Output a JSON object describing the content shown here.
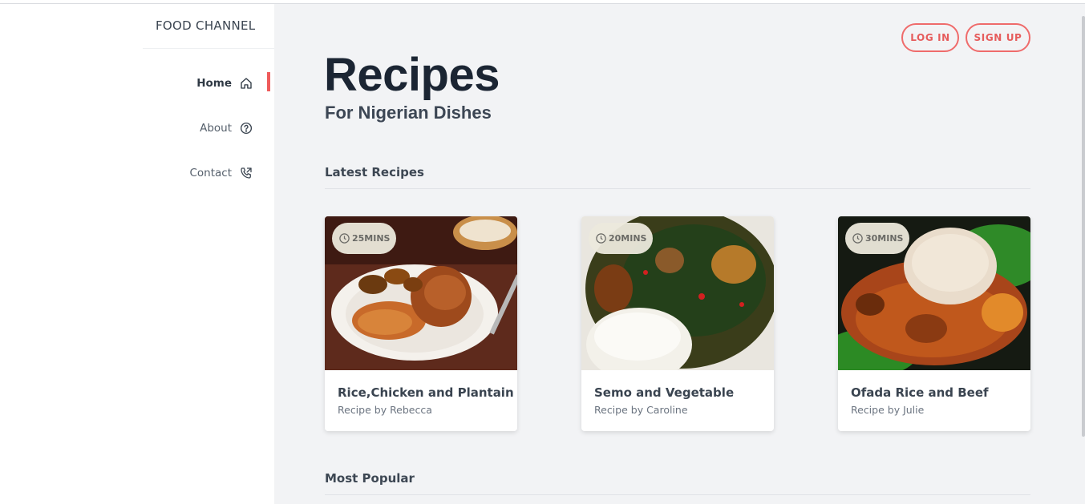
{
  "brand": "FOOD CHANNEL",
  "nav": [
    {
      "label": "Home",
      "icon": "home-icon",
      "active": true
    },
    {
      "label": "About",
      "icon": "question-icon",
      "active": false
    },
    {
      "label": "Contact",
      "icon": "phone-icon",
      "active": false
    }
  ],
  "auth": {
    "login": "LOG IN",
    "signup": "SIGN UP"
  },
  "hero": {
    "title": "Recipes",
    "subtitle": "For Nigerian Dishes"
  },
  "sections": {
    "latest": "Latest Recipes",
    "popular": "Most Popular"
  },
  "recipes": [
    {
      "time": "25MINS",
      "name": "Rice,Chicken and Plantain",
      "by": "Recipe by Rebecca"
    },
    {
      "time": "20MINS",
      "name": "Semo and Vegetable",
      "by": "Recipe by Caroline"
    },
    {
      "time": "30MINS",
      "name": "Ofada Rice and Beef",
      "by": "Recipe by Julie"
    }
  ],
  "colors": {
    "accent": "#ef5b5b",
    "sidebar": "#ffffff",
    "background": "#f2f3f5"
  }
}
